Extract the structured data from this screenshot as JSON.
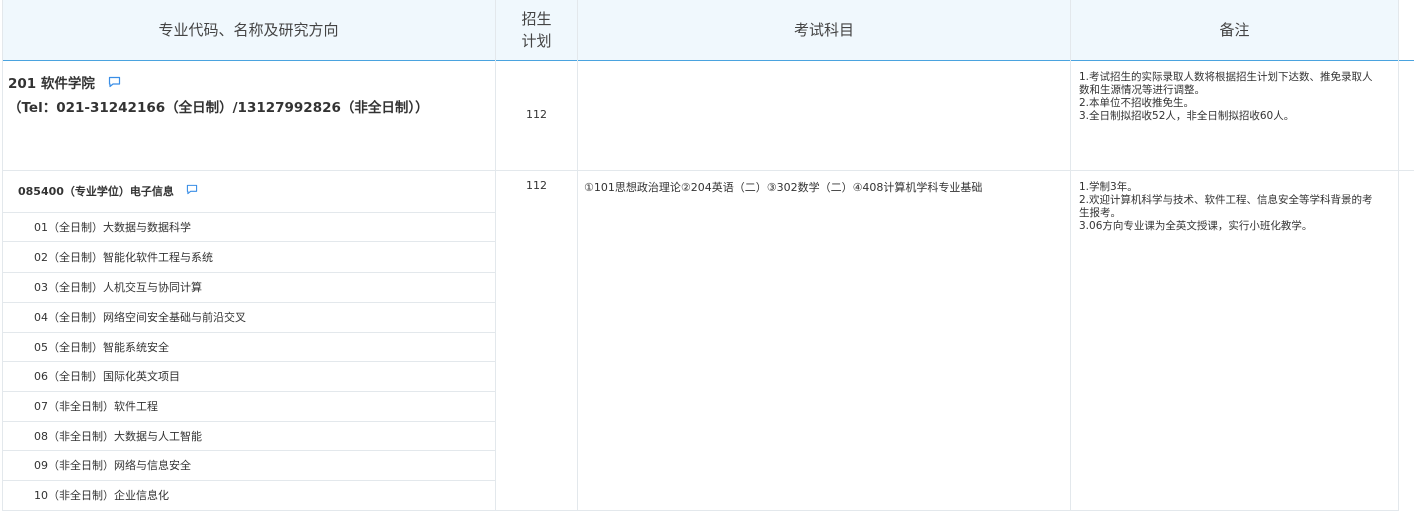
{
  "header": {
    "col_major": "专业代码、名称及研究方向",
    "col_plan_line1": "招生",
    "col_plan_line2": "计划",
    "col_exam": "考试科目",
    "col_note": "备注"
  },
  "college": {
    "name": "201 软件学院",
    "tel": "（Tel：021-31242166（全日制）/13127992826（非全日制））",
    "plan": "112",
    "notes": [
      "1.考试招生的实际录取人数将根据招生计划下达数、推免录取人",
      "数和生源情况等进行调整。",
      "2.本单位不招收推免生。",
      "3.全日制拟招收52人，非全日制拟招收60人。"
    ]
  },
  "major": {
    "name": "085400（专业学位）电子信息",
    "plan": "112",
    "exam": "①101思想政治理论②204英语（二）③302数学（二）④408计算机学科专业基础",
    "notes": [
      "1.学制3年。",
      "2.欢迎计算机科学与技术、软件工程、信息安全等学科背景的考",
      "生报考。",
      "3.06方向专业课为全英文授课，实行小班化教学。"
    ],
    "directions": [
      "01（全日制）大数据与数据科学",
      "02（全日制）智能化软件工程与系统",
      "03（全日制）人机交互与协同计算",
      "04（全日制）网络空间安全基础与前沿交叉",
      "05（全日制）智能系统安全",
      "06（全日制）国际化英文项目",
      "07（非全日制）软件工程",
      "08（非全日制）大数据与人工智能",
      "09（非全日制）网络与信息安全",
      "10（非全日制）企业信息化"
    ]
  },
  "colors": {
    "header_bg": "#f0f8fd",
    "accent": "#4aa3df",
    "border": "#e3e8ec"
  }
}
